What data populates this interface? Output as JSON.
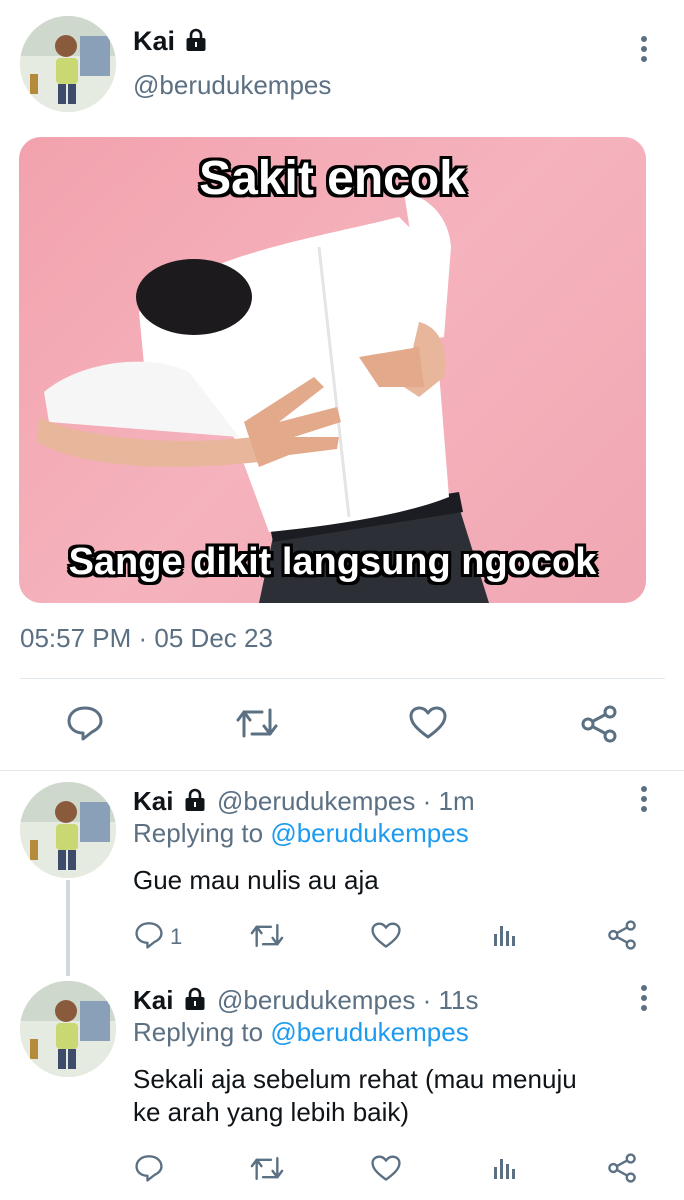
{
  "tweet": {
    "author_name": "Kai",
    "author_handle": "@berudukempes",
    "timestamp": "05:57 PM · 05 Dec 23",
    "image_top_caption": "Sakit encok",
    "image_bottom_caption": "Sange dikit langsung ngocok"
  },
  "replies": [
    {
      "author_name": "Kai",
      "meta": "@berudukempes · 1m",
      "replying_prefix": "Replying to",
      "replying_handle": "@berudukempes",
      "text": "Gue mau nulis au aja",
      "reply_count": "1"
    },
    {
      "author_name": "Kai",
      "meta": "@berudukempes · 11s",
      "replying_prefix": "Replying to",
      "replying_handle": "@berudukempes",
      "text_line1": "Sekali aja sebelum rehat (mau menuju",
      "text_line2": "ke arah yang lebih baik)",
      "reply_count": ""
    }
  ],
  "icons": [
    "lock-icon",
    "more-icon",
    "reply-icon",
    "retweet-icon",
    "like-icon",
    "share-icon",
    "analytics-icon"
  ],
  "colors": {
    "accent": "#1d9bf0",
    "secondary_text": "#5b7083",
    "divider": "#e1e8ed",
    "meme_background": "#f2a2ad"
  }
}
